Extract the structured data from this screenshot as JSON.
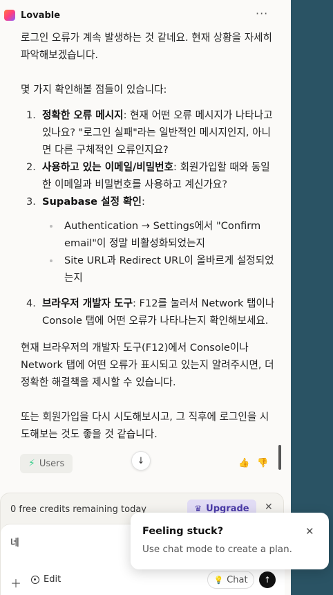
{
  "app": {
    "name": "Lovable",
    "more_label": "···"
  },
  "message": {
    "intro": "로그인 오류가 계속 발생하는 것 같네요. 현재 상황을 자세히 파악해보겠습니다.",
    "lead": "몇 가지 확인해볼 점들이 있습니다:",
    "steps": [
      {
        "num": "1.",
        "title": "정확한 오류 메시지",
        "text": ": 현재 어떤 오류 메시지가 나타나고 있나요? \"로그인 실패\"라는 일반적인 메시지인지, 아니면 다른 구체적인 오류인지요?"
      },
      {
        "num": "2.",
        "title": "사용하고 있는 이메일/비밀번호",
        "text": ": 회원가입할 때와 동일한 이메일과 비밀번호를 사용하고 계신가요?"
      },
      {
        "num": "3.",
        "title": "Supabase 설정 확인",
        "text": ":"
      },
      {
        "num": "4.",
        "title": "브라우저 개발자 도구",
        "text": ": F12를 눌러서 Network 탭이나 Console 탭에 어떤 오류가 나타나는지 확인해보세요."
      }
    ],
    "sub_items": [
      "Authentication → Settings에서 \"Confirm email\"이 정말 비활성화되었는지",
      "Site URL과 Redirect URL이 올바르게 설정되었는지"
    ],
    "para2": "현재 브라우저의 개발자 도구(F12)에서 Console이나 Network 탭에 어떤 오류가 표시되고 있는지 알려주시면, 더 정확한 해결책을 제시할 수 있습니다.",
    "para3": "또는 회원가입을 다시 시도해보시고, 그 직후에 로그인을 시도해보는 것도 좋을 것 같습니다."
  },
  "actions": {
    "users_label": "Users"
  },
  "composer": {
    "credits_text": "0 free credits remaining today",
    "upgrade_label": "Upgrade",
    "input_value": "네",
    "edit_label": "Edit",
    "chat_label": "Chat"
  },
  "toast": {
    "title": "Feeling stuck?",
    "body": "Use chat mode to create a plan."
  },
  "colors": {
    "accent_supabase": "#3ecf8e",
    "upgrade_bg": "#e1dcf5",
    "upgrade_text": "#4a3aa8",
    "sidebar": "#2a5364"
  }
}
